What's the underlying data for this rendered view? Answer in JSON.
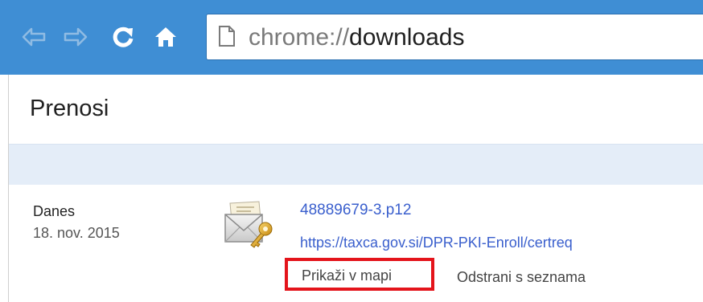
{
  "toolbar": {
    "icons": {
      "back": "back-arrow-icon",
      "forward": "forward-arrow-icon",
      "reload": "reload-icon",
      "home": "home-icon",
      "page": "page-icon"
    },
    "url_scheme": "chrome://",
    "url_host": "downloads",
    "colors": {
      "bar": "#3f8ed4"
    }
  },
  "page": {
    "title": "Prenosi"
  },
  "downloads": {
    "group_label": "Danes",
    "group_date": "18. nov. 2015",
    "item": {
      "icon": "certificate-envelope-key-icon",
      "file_name": "48889679-3.p12",
      "source_url": "https://taxca.gov.si/DPR-PKI-Enroll/certreq",
      "show_in_folder": "Prikaži v mapi",
      "remove_from_list": "Odstrani s seznama"
    }
  },
  "colors": {
    "link": "#3a5fcd",
    "highlight": "#e4141b",
    "section_bar": "#e4edf8"
  }
}
